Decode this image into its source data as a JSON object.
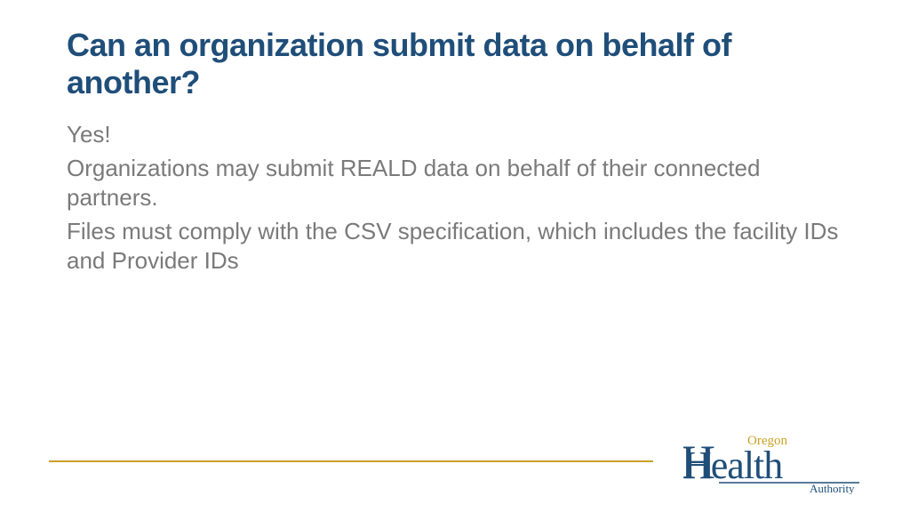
{
  "title": "Can an organization submit data on behalf of another?",
  "body": {
    "p1": "Yes!",
    "p2": "Organizations may submit REALD data on behalf of their connected partners.",
    "p3": "Files must comply with the CSV specification, which includes the facility IDs and Provider IDs"
  },
  "logo": {
    "top_text": "Oregon",
    "main_text": "Health",
    "sub_text": "Authority"
  },
  "colors": {
    "title": "#1f4e79",
    "body": "#7a7a7a",
    "accent": "#c9a227",
    "logo_primary": "#1f4e79",
    "logo_accent": "#c9a227"
  }
}
